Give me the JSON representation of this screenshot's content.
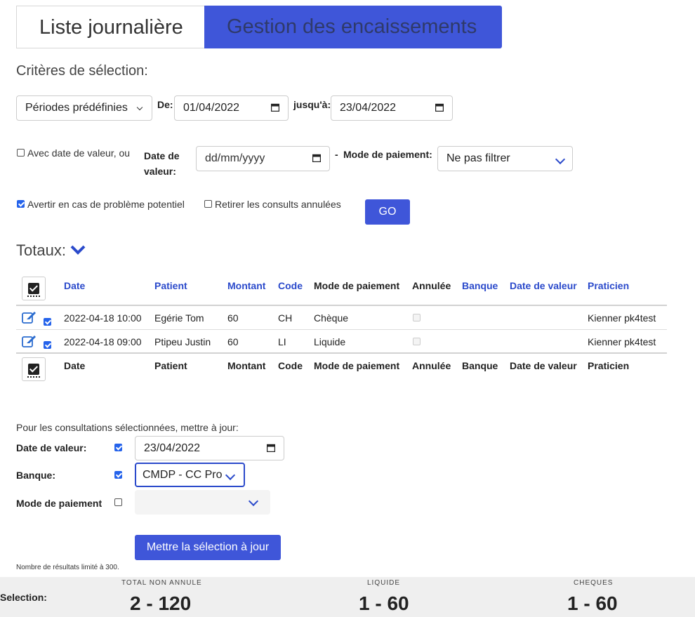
{
  "tabs": [
    {
      "label": "Liste journalière",
      "active": false
    },
    {
      "label": "Gestion des encaissements",
      "active": true
    }
  ],
  "criteria": {
    "title": "Critères de sélection:",
    "period_select": "Périodes prédéfinies",
    "from_label": "De:",
    "from_date": "01/04/2022",
    "to_label": "jusqu'à:",
    "to_date": "23/04/2022",
    "value_date_checkbox_label": "Avec date de valeur, ou",
    "value_date_label_line1": "Date de",
    "value_date_label_line2": "valeur:",
    "value_date_placeholder": "dd/mm/yyyy",
    "dash": "-",
    "payment_mode_label": "Mode de paiement:",
    "payment_mode_value": "Ne pas filtrer",
    "warn_label": "Avertir en cas de problème potentiel",
    "warn_checked": true,
    "remove_cancelled_label": "Retirer les consults annulées",
    "remove_cancelled_checked": false,
    "go_label": "GO"
  },
  "totals": {
    "label": "Totaux:"
  },
  "table": {
    "headers": [
      "Date",
      "Patient",
      "Montant",
      "Code",
      "Mode de paiement",
      "Annulée",
      "Banque",
      "Date de valeur",
      "Praticien"
    ],
    "rows": [
      {
        "date": "2022-04-18 10:00",
        "patient": "Egérie Tom",
        "montant": "60",
        "code": "CH",
        "mode": "Chèque",
        "annulee": false,
        "banque": "",
        "date_valeur": "",
        "praticien": "Kienner pk4test",
        "selected": true
      },
      {
        "date": "2022-04-18 09:00",
        "patient": "Ptipeu Justin",
        "montant": "60",
        "code": "LI",
        "mode": "Liquide",
        "annulee": false,
        "banque": "",
        "date_valeur": "",
        "praticien": "Kienner pk4test",
        "selected": true
      }
    ]
  },
  "update": {
    "intro": "Pour les consultations sélectionnées, mettre à jour:",
    "value_date_label": "Date de valeur:",
    "value_date_checked": true,
    "value_date": "23/04/2022",
    "bank_label": "Banque:",
    "bank_checked": true,
    "bank_value": "CMDP - CC Pro",
    "payment_label": "Mode de paiement",
    "payment_checked": false,
    "payment_value": "",
    "submit_label": "Mettre la sélection à jour"
  },
  "limit_note": "Nombre de résultats limité à 300.",
  "footer": {
    "selection_label": "Selection:",
    "stats": [
      {
        "label": "TOTAL NON ANNULE",
        "value": "2 - 120"
      },
      {
        "label": "LIQUIDE",
        "value": "1 - 60"
      },
      {
        "label": "CHEQUES",
        "value": "1 - 60"
      }
    ]
  },
  "colors": {
    "accent": "#3f56d9",
    "link": "#2b4acb",
    "checkbox": "#2563eb"
  }
}
